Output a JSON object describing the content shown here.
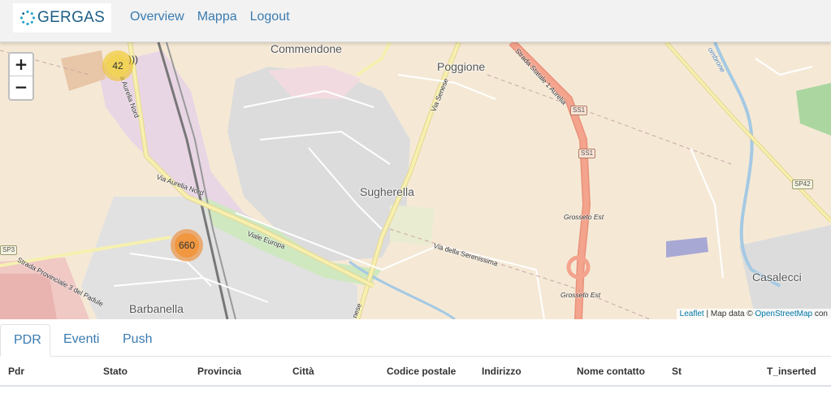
{
  "brand": {
    "name": "GERGAS"
  },
  "nav": {
    "items": [
      "Overview",
      "Mappa",
      "Logout"
    ]
  },
  "map": {
    "zoom_in": "+",
    "zoom_out": "−",
    "clusters": [
      {
        "count": "42"
      },
      {
        "count": "660"
      }
    ],
    "places": {
      "commendone": "Commendone",
      "poggione": "Poggione",
      "sugherella": "Sugherella",
      "barbanella": "Barbanella",
      "casalecci": "Casalecci"
    },
    "roads": {
      "aurelia_nord_1": "Via Aurelia Nord",
      "aurelia_nord_2": "Via Aurelia Nord",
      "viale_europa": "Viale Europa",
      "serenissima": "Via della Serenissima",
      "senese_1": "Via Senese",
      "senese_2": "nese",
      "statale": "Strada Statale 1 Aurelia",
      "provinciale": "Strada Provinciale 3 del Padule",
      "grosseto_est_1": "Grosseto Est",
      "grosseto_est_2": "Grosseto Est",
      "ombrone": "ombrone"
    },
    "shields": {
      "ss1_a": "SS1",
      "ss1_b": "SS1",
      "sp42": "SP42",
      "sp3": "SP3"
    },
    "attribution": {
      "leaflet": "Leaflet",
      "sep": " | Map data © ",
      "osm": "OpenStreetMap",
      "suffix": " con"
    }
  },
  "tabs": [
    "PDR",
    "Eventi",
    "Push"
  ],
  "table": {
    "columns": [
      "Pdr",
      "Stato",
      "Provincia",
      "Città",
      "Codice postale",
      "Indirizzo",
      "Nome contatto",
      "St",
      "T_inserted"
    ]
  }
}
